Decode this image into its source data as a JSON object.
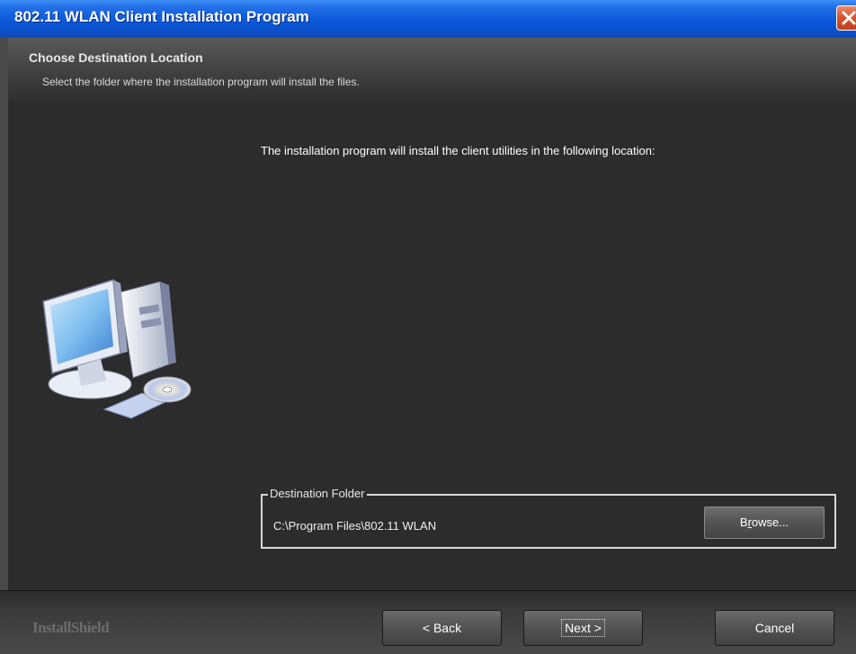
{
  "window": {
    "title": "802.11 WLAN Client Installation Program"
  },
  "header": {
    "title": "Choose Destination Location",
    "subtitle": "Select the folder where the installation program will install the files."
  },
  "main": {
    "message": "The installation program will install the client utilities in the following location:"
  },
  "destination": {
    "group_label": "Destination Folder",
    "path": "C:\\Program Files\\802.11 WLAN",
    "browse_label": "Browse..."
  },
  "footer": {
    "brand": "InstallShield",
    "back_label": "< Back",
    "next_label": "Next >",
    "cancel_label": "Cancel"
  },
  "icons": {
    "close": "close-icon",
    "computer": "computer-graphic",
    "cd": "cd-disc-graphic"
  },
  "colors": {
    "titlebar": "#0b58da",
    "background": "#2c2c2c",
    "close_button": "#d4522c"
  }
}
